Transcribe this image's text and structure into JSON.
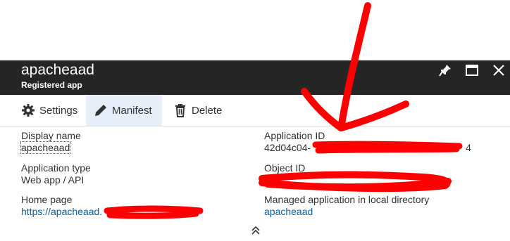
{
  "header": {
    "title": "apacheaad",
    "subtitle": "Registered app",
    "background": "#252525"
  },
  "window_controls": {
    "pin_icon": "pin-icon",
    "maximize_icon": "maximize-icon",
    "close_icon": "close-icon"
  },
  "toolbar": {
    "settings_label": "Settings",
    "manifest_label": "Manifest",
    "delete_label": "Delete"
  },
  "essentials": {
    "display_name_label": "Display name",
    "display_name_value": "apacheaad",
    "app_type_label": "Application type",
    "app_type_value": "Web app / API",
    "home_page_label": "Home page",
    "home_page_value": "https://apacheaad.",
    "app_id_label": "Application ID",
    "app_id_value": "42d04c04-",
    "app_id_value_tail": "4",
    "object_id_label": "Object ID",
    "managed_app_label": "Managed application in local directory",
    "managed_app_value": "apacheaad"
  },
  "colors": {
    "link": "#0063b1",
    "annotation": "#ff0000",
    "active_tab": "#e5eef9"
  }
}
